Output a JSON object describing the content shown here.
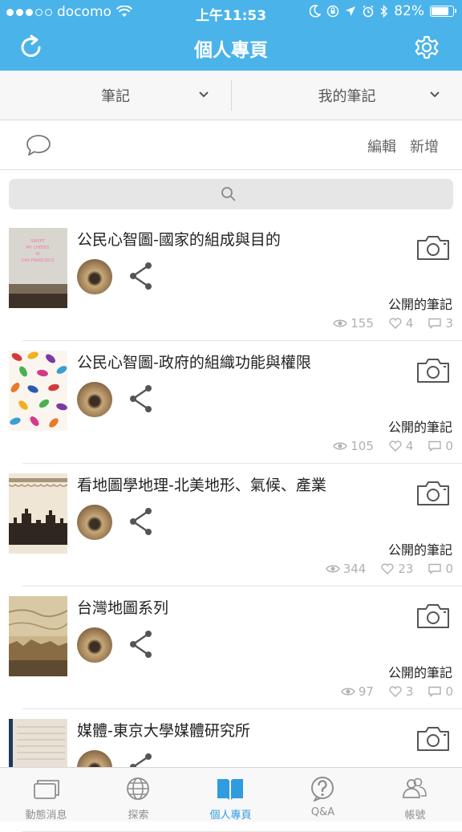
{
  "status_bar": {
    "carrier": "docomo",
    "time": "上午11:53",
    "battery": "82%",
    "battery_level": 0.82
  },
  "nav": {
    "title": "個人專頁",
    "left_icon": "refresh-icon",
    "right_icon": "gear-icon"
  },
  "filters": {
    "type_label": "筆記",
    "scope_label": "我的筆記"
  },
  "actions": {
    "edit_label": "編輯",
    "add_label": "新增"
  },
  "notes": [
    {
      "title": "公民心智圖-國家的組成與目的",
      "visibility": "公開的筆記",
      "views": "155",
      "likes": "4",
      "comments": "3"
    },
    {
      "title": "公民心智圖-政府的組織功能與權限",
      "visibility": "公開的筆記",
      "views": "105",
      "likes": "4",
      "comments": "0"
    },
    {
      "title": "看地圖學地理-北美地形、氣候、產業",
      "visibility": "公開的筆記",
      "views": "344",
      "likes": "23",
      "comments": "0"
    },
    {
      "title": "台灣地圖系列",
      "visibility": "公開的筆記",
      "views": "97",
      "likes": "3",
      "comments": "0"
    },
    {
      "title": "媒體-東京大學媒體研究所",
      "visibility": "",
      "views": "",
      "likes": "",
      "comments": ""
    }
  ],
  "tabs": [
    {
      "label": "動態消息",
      "icon": "feed-icon"
    },
    {
      "label": "探索",
      "icon": "globe-icon"
    },
    {
      "label": "個人專頁",
      "icon": "book-icon"
    },
    {
      "label": "Q&A",
      "icon": "question-icon"
    },
    {
      "label": "帳號",
      "icon": "users-icon"
    }
  ],
  "colors": {
    "brand": "#4ab3ea",
    "active_tab": "#2f9be0"
  }
}
